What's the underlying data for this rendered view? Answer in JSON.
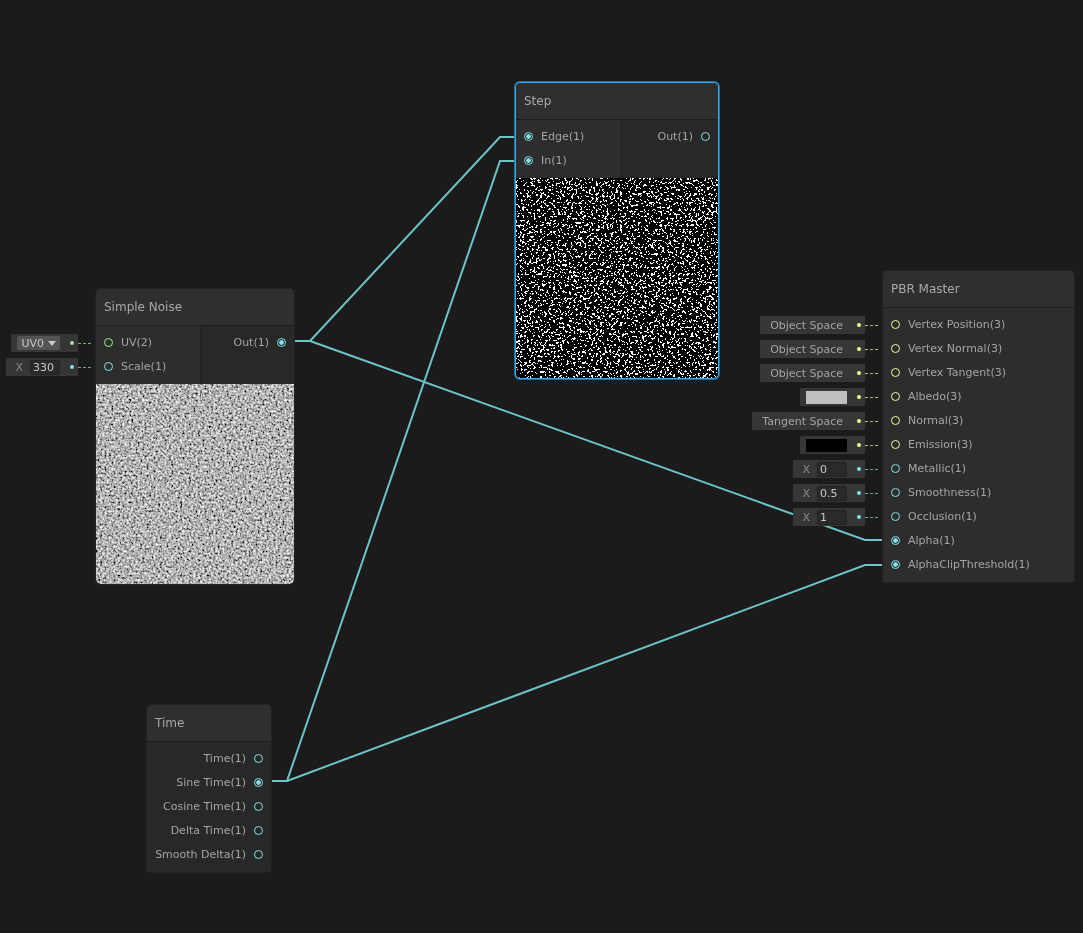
{
  "nodes": [
    {
      "title": "Simple Noise",
      "selected": false,
      "preview": {
        "kind": "noise"
      },
      "inputs": [
        {
          "label": "UV(2)",
          "kind": "vector2",
          "connected": false,
          "field": {
            "kind": "dropdown",
            "value": "UV0"
          }
        },
        {
          "label": "Scale(1)",
          "kind": "vector1",
          "connected": false,
          "field": {
            "kind": "number",
            "axis": "X",
            "value": "330"
          }
        }
      ],
      "outputs": [
        {
          "label": "Out(1)",
          "kind": "vector1",
          "connected": true
        }
      ]
    },
    {
      "title": "Step",
      "selected": true,
      "preview": {
        "kind": "threshold"
      },
      "inputs": [
        {
          "label": "Edge(1)",
          "kind": "vector1",
          "connected": true
        },
        {
          "label": "In(1)",
          "kind": "vector1",
          "connected": true
        }
      ],
      "outputs": [
        {
          "label": "Out(1)",
          "kind": "vector1",
          "connected": false
        }
      ]
    },
    {
      "title": "PBR Master",
      "selected": false,
      "inputs": [
        {
          "label": "Vertex Position(3)",
          "kind": "vector3",
          "connected": false,
          "field": {
            "kind": "label",
            "value": "Object Space"
          }
        },
        {
          "label": "Vertex Normal(3)",
          "kind": "vector3",
          "connected": false,
          "field": {
            "kind": "label",
            "value": "Object Space"
          }
        },
        {
          "label": "Vertex Tangent(3)",
          "kind": "vector3",
          "connected": false,
          "field": {
            "kind": "label",
            "value": "Object Space"
          }
        },
        {
          "label": "Albedo(3)",
          "kind": "vector3",
          "connected": false,
          "field": {
            "kind": "color",
            "color": "#c0c0c0"
          }
        },
        {
          "label": "Normal(3)",
          "kind": "vector3",
          "connected": false,
          "field": {
            "kind": "label",
            "value": "Tangent Space"
          }
        },
        {
          "label": "Emission(3)",
          "kind": "vector3",
          "connected": false,
          "field": {
            "kind": "color",
            "color": "#000000"
          }
        },
        {
          "label": "Metallic(1)",
          "kind": "vector1",
          "connected": false,
          "field": {
            "kind": "number",
            "axis": "X",
            "value": "0"
          }
        },
        {
          "label": "Smoothness(1)",
          "kind": "vector1",
          "connected": false,
          "field": {
            "kind": "number",
            "axis": "X",
            "value": "0.5"
          }
        },
        {
          "label": "Occlusion(1)",
          "kind": "vector1",
          "connected": false,
          "field": {
            "kind": "number",
            "axis": "X",
            "value": "1"
          }
        },
        {
          "label": "Alpha(1)",
          "kind": "vector1",
          "connected": true
        },
        {
          "label": "AlphaClipThreshold(1)",
          "kind": "vector1",
          "connected": true
        }
      ]
    },
    {
      "title": "Time",
      "selected": false,
      "outputs": [
        {
          "label": "Time(1)",
          "kind": "vector1",
          "connected": false
        },
        {
          "label": "Sine Time(1)",
          "kind": "vector1",
          "connected": true
        },
        {
          "label": "Cosine Time(1)",
          "kind": "vector1",
          "connected": false
        },
        {
          "label": "Delta Time(1)",
          "kind": "vector1",
          "connected": false
        },
        {
          "label": "Smooth Delta(1)",
          "kind": "vector1",
          "connected": false
        }
      ]
    }
  ]
}
